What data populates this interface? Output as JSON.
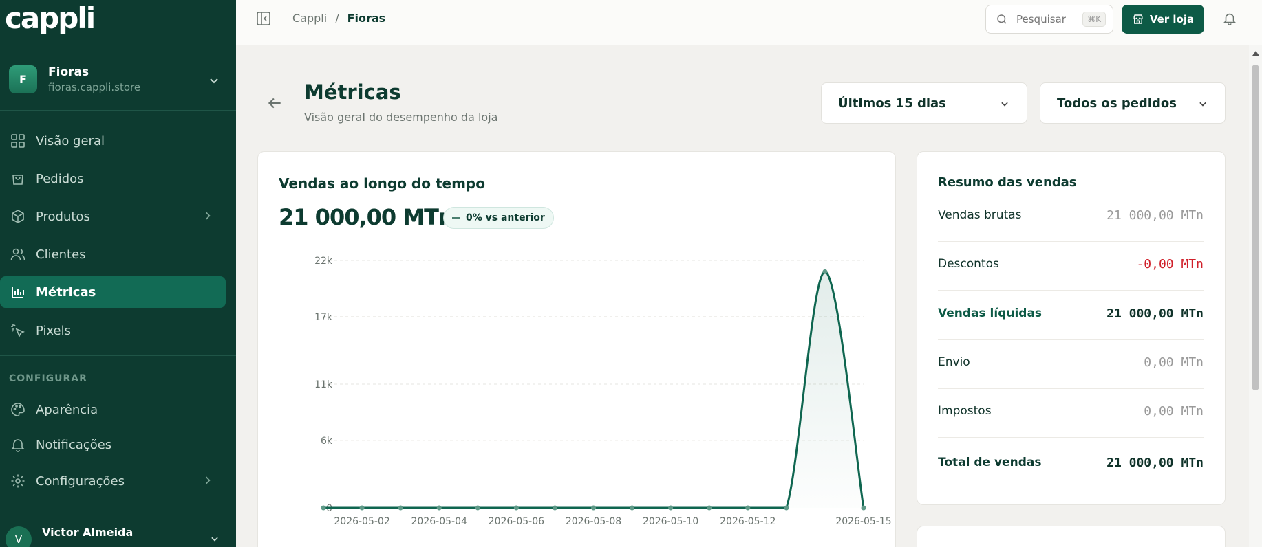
{
  "app": {
    "logo": "cappli"
  },
  "store": {
    "initial": "F",
    "name": "Fioras",
    "url": "fioras.cappli.store"
  },
  "sidebar": {
    "items": [
      {
        "label": "Visão geral"
      },
      {
        "label": "Pedidos"
      },
      {
        "label": "Produtos"
      },
      {
        "label": "Clientes"
      },
      {
        "label": "Métricas"
      },
      {
        "label": "Pixels"
      }
    ],
    "section_label": "CONFIGURAR",
    "config_items": [
      {
        "label": "Aparência"
      },
      {
        "label": "Notificações"
      },
      {
        "label": "Configurações"
      }
    ]
  },
  "user": {
    "initial": "V",
    "name": "Victor Almeida"
  },
  "topbar": {
    "breadcrumb": [
      "Cappli",
      "/",
      "Fioras"
    ],
    "search_placeholder": "Pesquisar",
    "search_shortcut": "⌘K",
    "view_store_label": "Ver loja"
  },
  "page": {
    "title": "Métricas",
    "subtitle": "Visão geral do desempenho da loja"
  },
  "filters": {
    "period": "Últimos 15 dias",
    "orders": "Todos os pedidos"
  },
  "chart_card": {
    "title": "Vendas ao longo do tempo",
    "total": "21 000,00 MTn",
    "badge": "0% vs anterior"
  },
  "summary": {
    "title": "Resumo das vendas",
    "rows": [
      {
        "label": "Vendas brutas",
        "value": "21 000,00 MTn"
      },
      {
        "label": "Descontos",
        "value": "-0,00 MTn"
      },
      {
        "label": "Vendas líquidas",
        "value": "21 000,00 MTn"
      },
      {
        "label": "Envio",
        "value": "0,00 MTn"
      },
      {
        "label": "Impostos",
        "value": "0,00 MTn"
      },
      {
        "label": "Total de vendas",
        "value": "21 000,00 MTn"
      }
    ]
  },
  "colors": {
    "sidebar_bg": "#0d3b30",
    "accent": "#0d5a46",
    "line": "#0f6650",
    "negative": "#d0202a"
  },
  "chart_data": {
    "type": "area",
    "x": [
      "2026-05-01",
      "2026-05-02",
      "2026-05-03",
      "2026-05-04",
      "2026-05-05",
      "2026-05-06",
      "2026-05-07",
      "2026-05-08",
      "2026-05-09",
      "2026-05-10",
      "2026-05-11",
      "2026-05-12",
      "2026-05-13",
      "2026-05-14",
      "2026-05-15"
    ],
    "x_tick_labels": [
      "2026-05-02",
      "2026-05-04",
      "2026-05-06",
      "2026-05-08",
      "2026-05-10",
      "2026-05-12",
      "2026-05-15"
    ],
    "series": [
      {
        "values": [
          0,
          0,
          0,
          0,
          0,
          0,
          0,
          0,
          0,
          0,
          0,
          0,
          0,
          21000,
          0
        ]
      }
    ],
    "y_ticks": [
      0,
      6000,
      11000,
      17000,
      22000
    ],
    "y_tick_labels": [
      "0",
      "6k",
      "11k",
      "17k",
      "22k"
    ],
    "ylim": [
      0,
      22000
    ],
    "grid": true,
    "title": "Vendas ao longo do tempo"
  }
}
